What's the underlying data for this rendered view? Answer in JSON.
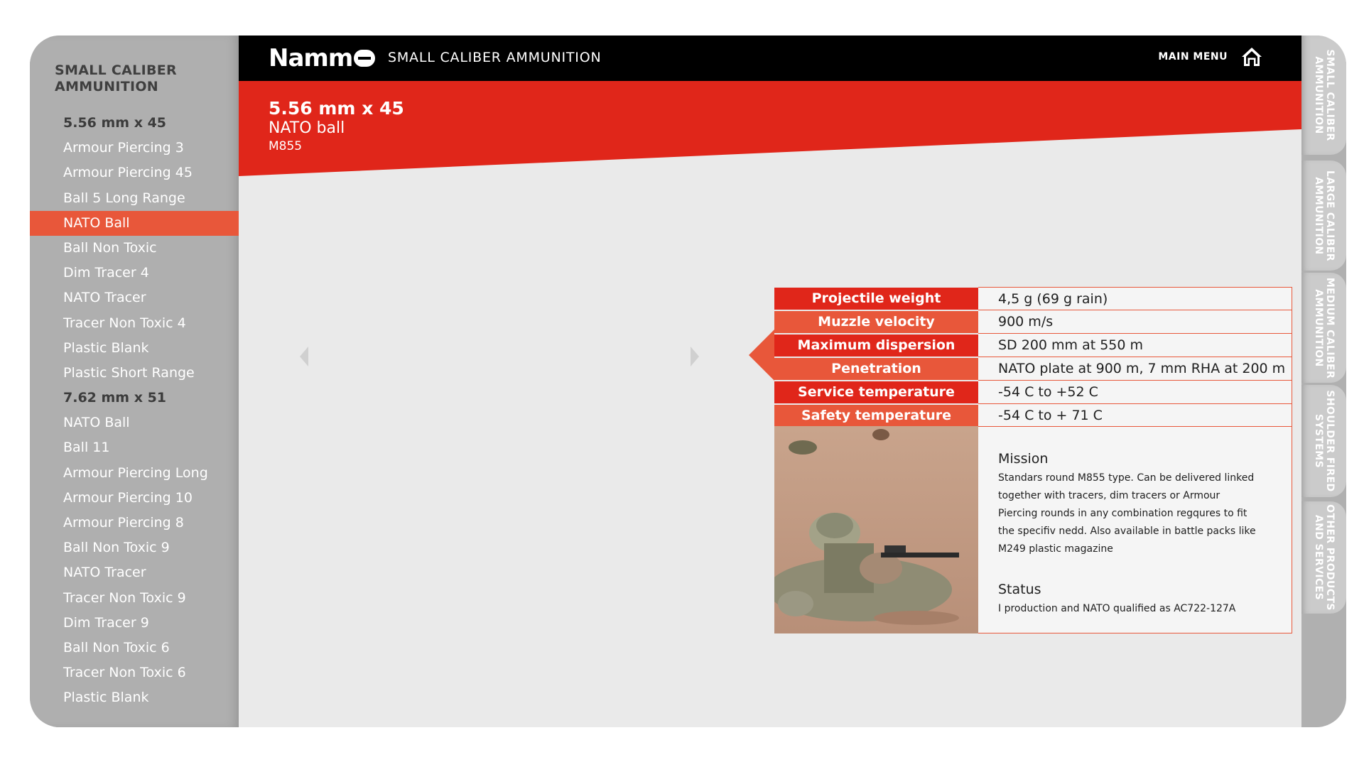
{
  "sidebar": {
    "title": "SMALL CALIBER\nAMMUNITION",
    "items": [
      {
        "label": "5.56 mm x 45",
        "type": "group"
      },
      {
        "label": "Armour Piercing 3",
        "type": "item"
      },
      {
        "label": "Armour Piercing 45",
        "type": "item"
      },
      {
        "label": "Ball 5 Long Range",
        "type": "item"
      },
      {
        "label": "NATO Ball",
        "type": "item",
        "active": true
      },
      {
        "label": "Ball Non Toxic",
        "type": "item"
      },
      {
        "label": "Dim Tracer 4",
        "type": "item"
      },
      {
        "label": "NATO Tracer",
        "type": "item"
      },
      {
        "label": "Tracer Non Toxic 4",
        "type": "item"
      },
      {
        "label": "Plastic Blank",
        "type": "item"
      },
      {
        "label": "Plastic Short Range",
        "type": "item"
      },
      {
        "label": "7.62 mm x 51",
        "type": "group"
      },
      {
        "label": "NATO Ball",
        "type": "item"
      },
      {
        "label": "Ball 11",
        "type": "item"
      },
      {
        "label": "Armour Piercing Long",
        "type": "item"
      },
      {
        "label": "Armour Piercing 10",
        "type": "item"
      },
      {
        "label": "Armour Piercing 8",
        "type": "item"
      },
      {
        "label": "Ball Non Toxic 9",
        "type": "item"
      },
      {
        "label": "NATO Tracer",
        "type": "item"
      },
      {
        "label": "Tracer Non Toxic 9",
        "type": "item"
      },
      {
        "label": "Dim Tracer 9",
        "type": "item"
      },
      {
        "label": "Ball Non Toxic 6",
        "type": "item"
      },
      {
        "label": "Tracer Non Toxic 6",
        "type": "item"
      },
      {
        "label": "Plastic Blank",
        "type": "item"
      }
    ]
  },
  "header": {
    "logo": "Namm",
    "app_title": "SMALL CALIBER AMMUNITION",
    "main_menu_label": "MAIN MENU"
  },
  "product": {
    "title": "5.56 mm x 45",
    "subtitle": "NATO ball",
    "code": "M855"
  },
  "specs": [
    {
      "label": "Projectile weight",
      "value": "4,5 g (69 g rain)"
    },
    {
      "label": "Muzzle velocity",
      "value": "900 m/s"
    },
    {
      "label": "Maximum dispersion",
      "value": "SD 200 mm at 550 m"
    },
    {
      "label": "Penetration",
      "value": "NATO plate at 900 m, 7 mm RHA at 200 m"
    },
    {
      "label": "Service temperature",
      "value": "-54 C to +52 C"
    },
    {
      "label": "Safety temperature",
      "value": "-54 C to + 71 C"
    }
  ],
  "mission": {
    "heading": "Mission",
    "text": "Standars round M855 type. Can be delivered linked together with tracers, dim tracers or Armour Piercing rounds in any combination regqures to fit the specifiv nedd. Also available in battle packs like M249 plastic magazine"
  },
  "status": {
    "heading": "Status",
    "text": "I production and NATO qualified as AC722-127A"
  },
  "tabs": [
    {
      "label": "SMALL CALIBER\nAMMUNITION"
    },
    {
      "label": "LARGE CALIBER\nAMMUNITION"
    },
    {
      "label": "MEDIUM CALIBER\nAMMUNITION"
    },
    {
      "label": "SHOULDER FIRED\nSYSTEMS"
    },
    {
      "label": "OTHER PRODUCTS\nAND SERVICES"
    }
  ],
  "colors": {
    "accent_red": "#e0261a",
    "accent_orange": "#e8573a",
    "sidebar_gray": "#afafaf",
    "content_bg": "#eaeaea"
  }
}
